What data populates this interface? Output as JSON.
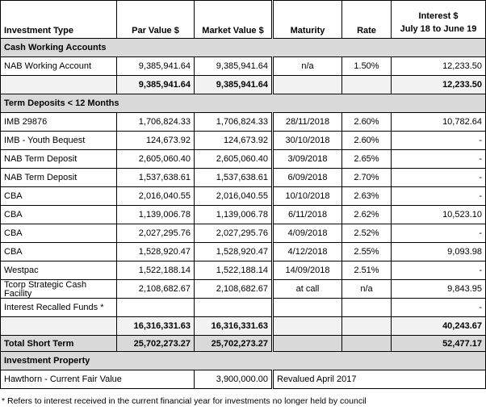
{
  "headers": {
    "investment_type": "Investment Type",
    "par_value": "Par Value $",
    "market_value": "Market Value $",
    "maturity": "Maturity",
    "rate": "Rate",
    "interest_line1": "Interest $",
    "interest_line2": "July 18 to June 19"
  },
  "cash": {
    "title": "Cash Working Accounts",
    "row": {
      "name": "NAB Working Account",
      "par": "9,385,941.64",
      "market": "9,385,941.64",
      "maturity": "n/a",
      "rate": "1.50%",
      "interest": "12,233.50"
    },
    "total": {
      "par": "9,385,941.64",
      "market": "9,385,941.64",
      "interest": "12,233.50"
    }
  },
  "term": {
    "title": "Term Deposits < 12 Months",
    "rows": [
      {
        "name": "IMB 29876",
        "par": "1,706,824.33",
        "market": "1,706,824.33",
        "maturity": "28/11/2018",
        "rate": "2.60%",
        "interest": "10,782.64"
      },
      {
        "name": "IMB - Youth Bequest",
        "par": "124,673.92",
        "market": "124,673.92",
        "maturity": "30/10/2018",
        "rate": "2.60%",
        "interest": "-"
      },
      {
        "name": "NAB Term Deposit",
        "par": "2,605,060.40",
        "market": "2,605,060.40",
        "maturity": "3/09/2018",
        "rate": "2.65%",
        "interest": "-"
      },
      {
        "name": "NAB Term Deposit",
        "par": "1,537,638.61",
        "market": "1,537,638.61",
        "maturity": "6/09/2018",
        "rate": "2.70%",
        "interest": "-"
      },
      {
        "name": "CBA",
        "par": "2,016,040.55",
        "market": "2,016,040.55",
        "maturity": "10/10/2018",
        "rate": "2.63%",
        "interest": "-"
      },
      {
        "name": "CBA",
        "par": "1,139,006.78",
        "market": "1,139,006.78",
        "maturity": "6/11/2018",
        "rate": "2.62%",
        "interest": "10,523.10"
      },
      {
        "name": "CBA",
        "par": "2,027,295.76",
        "market": "2,027,295.76",
        "maturity": "4/09/2018",
        "rate": "2.52%",
        "interest": "-"
      },
      {
        "name": "CBA",
        "par": "1,528,920.47",
        "market": "1,528,920.47",
        "maturity": "4/12/2018",
        "rate": "2.55%",
        "interest": "9,093.98"
      },
      {
        "name": "Westpac",
        "par": "1,522,188.14",
        "market": "1,522,188.14",
        "maturity": "14/09/2018",
        "rate": "2.51%",
        "interest": "-"
      }
    ],
    "tcorp": {
      "name": "Tcorp Strategic Cash Facility",
      "par": "2,108,682.67",
      "market": "2,108,682.67",
      "maturity": "at call",
      "rate": "n/a",
      "interest": "9,843.95"
    },
    "recalled": {
      "name": "Interest Recalled Funds *",
      "interest": "-"
    },
    "total": {
      "par": "16,316,331.63",
      "market": "16,316,331.63",
      "interest": "40,243.67"
    }
  },
  "short_term_total": {
    "label": "Total Short Term",
    "par": "25,702,273.27",
    "market": "25,702,273.27",
    "interest": "52,477.17"
  },
  "property": {
    "title": "Investment Property",
    "row": {
      "name": "Hawthorn - Current Fair Value",
      "market": "3,900,000.00",
      "note": "Revalued April 2017"
    }
  },
  "footnote": "* Refers to interest received in the current financial year for investments no longer held by council"
}
